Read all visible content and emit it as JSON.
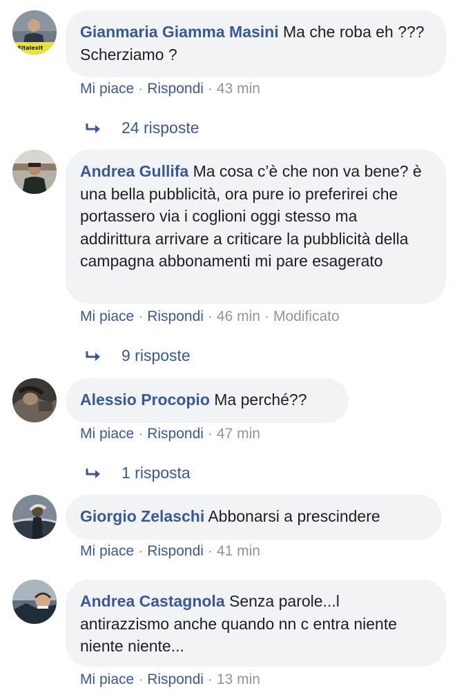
{
  "comments": [
    {
      "author": "Gianmaria Giamma Masini",
      "text": "Ma che roba eh ??? Scherziamo ?",
      "like_label": "Mi piace",
      "reply_label": "Rispondi",
      "time": "43 min",
      "replies_label": "24 risposte",
      "avatar_caption": "#italexit"
    },
    {
      "author": "Andrea Gullifa",
      "text": "Ma cosa c’è che non va bene? è una bella pubblicità, ora pure io preferirei che portassero via i coglioni oggi stesso ma addirittura arrivare a criticare la pubblicità della campagna abbonamenti mi pare esagerato",
      "like_label": "Mi piace",
      "reply_label": "Rispondi",
      "time": "46 min",
      "edited_label": "Modificato",
      "replies_label": "9 risposte"
    },
    {
      "author": "Alessio Procopio",
      "text": "Ma perché??",
      "like_label": "Mi piace",
      "reply_label": "Rispondi",
      "time": "47 min",
      "replies_label": "1 risposta"
    },
    {
      "author": "Giorgio Zelaschi",
      "text": "Abbonarsi a prescindere",
      "like_label": "Mi piace",
      "reply_label": "Rispondi",
      "time": "41 min"
    },
    {
      "author": "Andrea Castagnola",
      "text": "Senza parole...l antirazzismo anche quando nn c entra niente niente niente...",
      "like_label": "Mi piace",
      "reply_label": "Rispondi",
      "time": "13 min"
    }
  ],
  "colors": {
    "link": "#385898",
    "bubble": "#f2f3f5",
    "meta": "#90949c",
    "text": "#1c1e21"
  }
}
